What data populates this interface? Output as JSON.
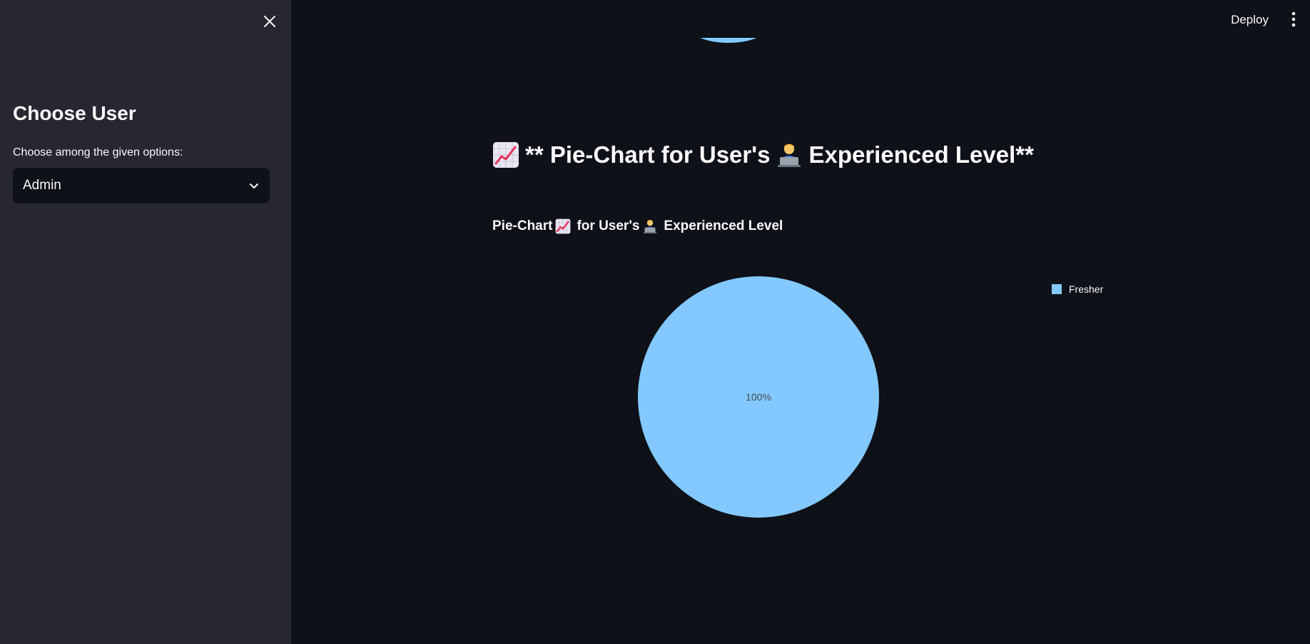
{
  "sidebar": {
    "title": "Choose User",
    "select_label": "Choose among the given options:",
    "select_value": "Admin"
  },
  "header": {
    "deploy_label": "Deploy"
  },
  "main": {
    "heading_prefix": "** Pie-Chart for User's",
    "heading_suffix": "Experienced Level**",
    "chart_title_part1": "Pie-Chart",
    "chart_title_part2": "for User's",
    "chart_title_part3": "Experienced Level"
  },
  "icons": {
    "close": "close-icon",
    "chevron": "chevron-down-icon",
    "menu": "kebab-menu-icon",
    "chart": "chart-increasing-icon",
    "technologist": "technologist-icon"
  },
  "colors": {
    "pie": "#83c9ff",
    "sidebar_bg": "#262730",
    "main_bg": "#0e1117"
  },
  "chart_data": {
    "type": "pie",
    "title": "Pie-Chart📈 for User's🧑‍💻 Experienced Level",
    "categories": [
      "Fresher"
    ],
    "values": [
      100
    ],
    "labels": [
      "100%"
    ],
    "legend": "right",
    "colors": [
      "#83c9ff"
    ]
  }
}
